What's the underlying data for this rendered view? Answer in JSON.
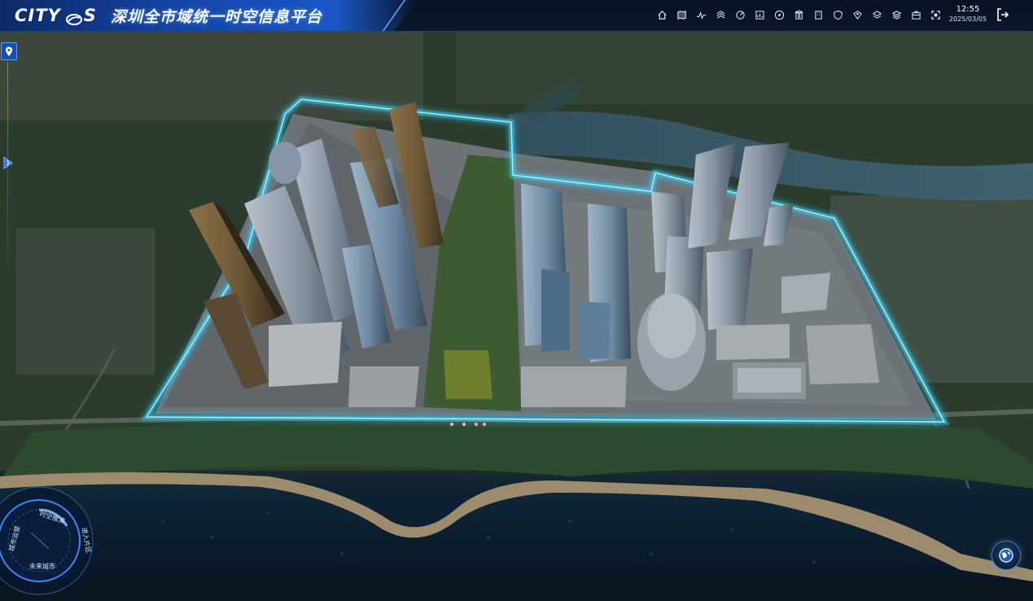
{
  "app": {
    "brand_left": "CITY",
    "brand_right": "S",
    "title": "深圳全市域统一时空信息平台"
  },
  "toolbar": {
    "items": [
      {
        "icon": "home-icon"
      },
      {
        "icon": "map-icon"
      },
      {
        "icon": "route-icon"
      },
      {
        "icon": "layers-stack-icon"
      },
      {
        "icon": "analysis-icon"
      },
      {
        "icon": "chart-icon"
      },
      {
        "icon": "compass-icon"
      },
      {
        "icon": "landmark-icon"
      },
      {
        "icon": "building-icon"
      },
      {
        "icon": "shield-icon"
      },
      {
        "icon": "location-shield-icon"
      },
      {
        "icon": "layers-icon"
      },
      {
        "icon": "stack-icon"
      },
      {
        "icon": "briefcase-icon"
      },
      {
        "icon": "fullscreen-icon"
      }
    ]
  },
  "clock": {
    "time": "12:55",
    "date": "2025/03/05"
  },
  "dial": {
    "top": "时空推演",
    "left": "城市运营",
    "bottom": "未来城市",
    "right": "进入片区"
  },
  "colors": {
    "accent": "#1a57c8",
    "boundary_glow": "#35d6ff",
    "water": "#0b2234"
  }
}
